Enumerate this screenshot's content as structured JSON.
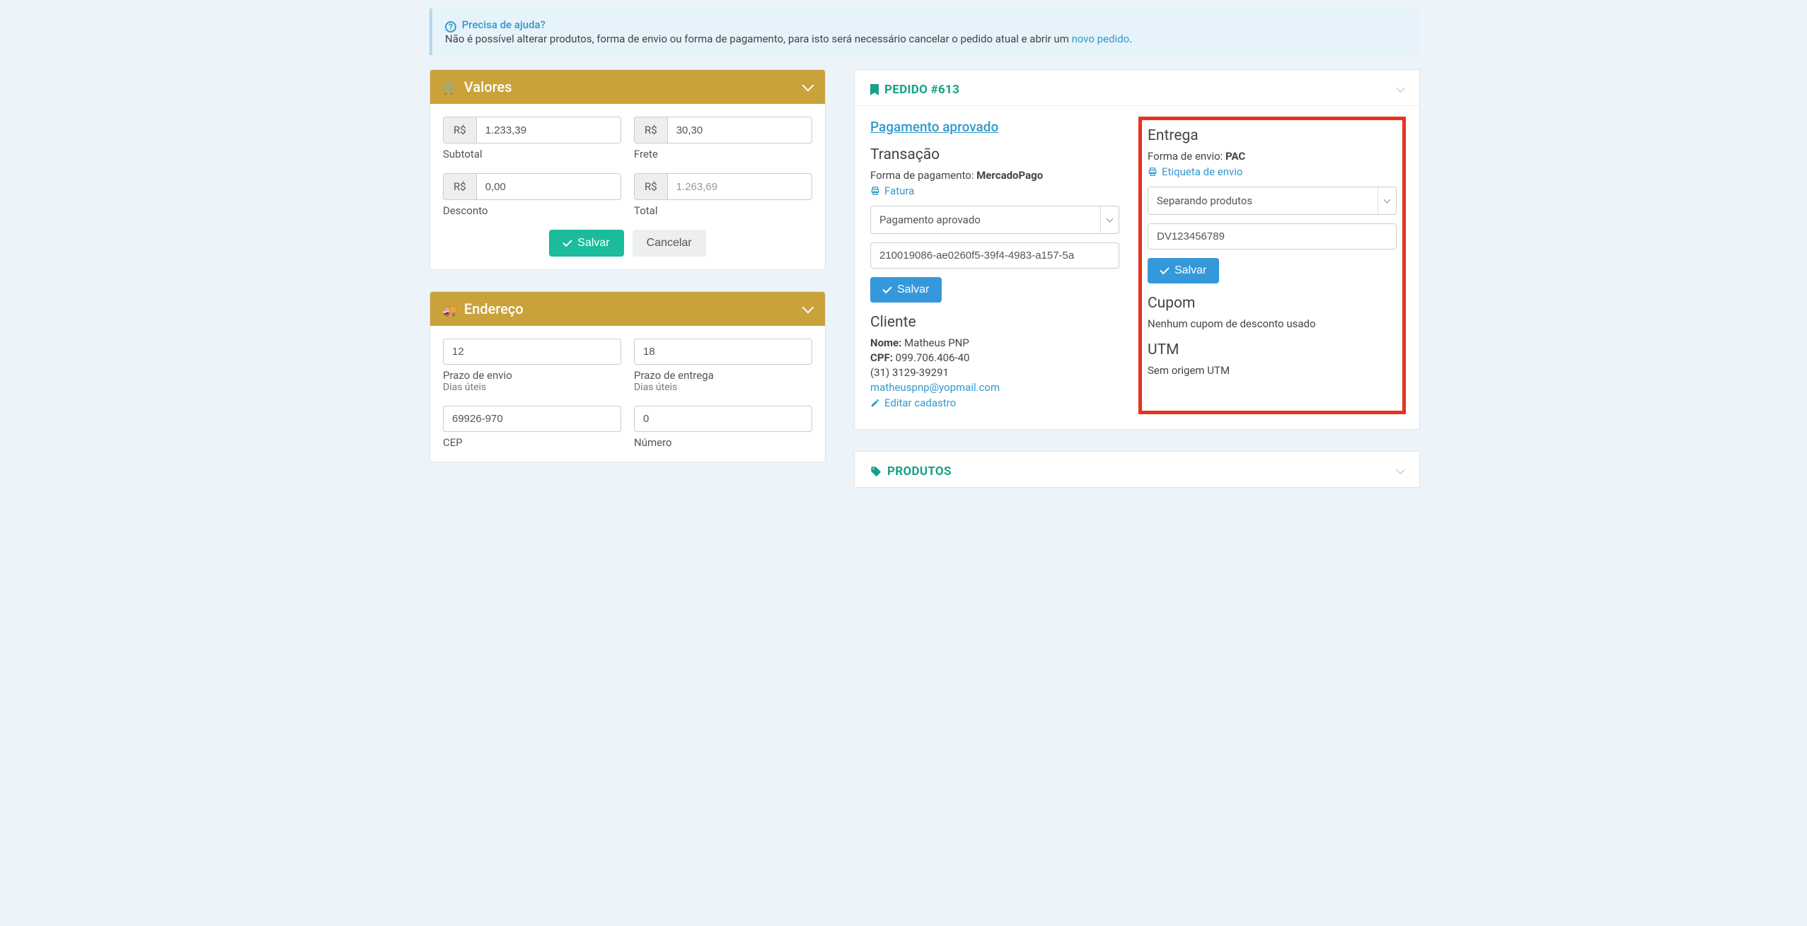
{
  "alert": {
    "help_label": "Precisa de ajuda?",
    "text_before": "Não é possível alterar produtos, forma de envio ou forma de pagamento, para isto será necessário cancelar o pedido atual e abrir um ",
    "link_label": "novo pedido",
    "text_after": "."
  },
  "currency_prefix": "R$",
  "valores": {
    "title": "Valores",
    "subtotal_value": "1.233,39",
    "subtotal_label": "Subtotal",
    "frete_value": "30,30",
    "frete_label": "Frete",
    "desconto_value": "0,00",
    "desconto_label": "Desconto",
    "total_value": "1.263,69",
    "total_label": "Total",
    "save_label": "Salvar",
    "cancel_label": "Cancelar"
  },
  "endereco": {
    "title": "Endereço",
    "prazo_envio_value": "12",
    "prazo_envio_label": "Prazo de envio",
    "prazo_entrega_value": "18",
    "prazo_entrega_label": "Prazo de entrega",
    "dias_uteis_label": "Dias úteis",
    "cep_value": "69926-970",
    "cep_label": "CEP",
    "numero_value": "0",
    "numero_label": "Número"
  },
  "pedido": {
    "header_title": "PEDIDO #613",
    "status_title": "Pagamento aprovado",
    "transacao": {
      "heading": "Transação",
      "forma_label": "Forma de pagamento: ",
      "forma_value": "MercadoPago",
      "fatura_label": "Fatura",
      "select_value": "Pagamento aprovado",
      "txid_value": "210019086-ae0260f5-39f4-4983-a157-5a",
      "save_label": "Salvar"
    },
    "cliente": {
      "heading": "Cliente",
      "nome_label": "Nome: ",
      "nome_value": "Matheus PNP",
      "cpf_label": "CPF: ",
      "cpf_value": "099.706.406-40",
      "phone": "(31) 3129-39291",
      "email": "matheuspnp@yopmail.com",
      "editar_label": "Editar cadastro"
    },
    "entrega": {
      "heading": "Entrega",
      "forma_label": "Forma de envio: ",
      "forma_value": "PAC",
      "etiqueta_label": "Etiqueta de envio",
      "select_value": "Separando produtos",
      "tracking_value": "DV123456789",
      "save_label": "Salvar"
    },
    "cupom": {
      "heading": "Cupom",
      "text": "Nenhum cupom de desconto usado"
    },
    "utm": {
      "heading": "UTM",
      "text": "Sem origem UTM"
    }
  },
  "produtos": {
    "header_title": "PRODUTOS"
  }
}
